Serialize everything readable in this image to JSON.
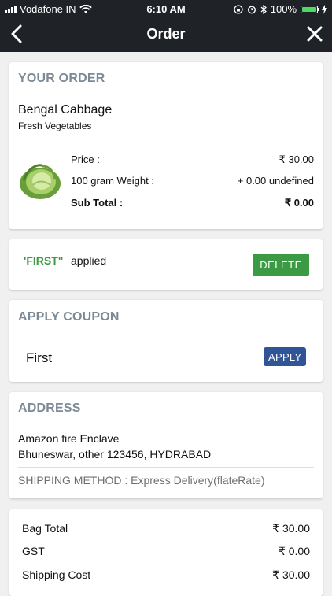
{
  "status_bar": {
    "carrier": "Vodafone IN",
    "time": "6:10 AM",
    "battery": "100%"
  },
  "header": {
    "title": "Order"
  },
  "order": {
    "section_title": "YOUR ORDER",
    "product_name": "Bengal Cabbage",
    "product_category": "Fresh Vegetables",
    "price_label": "Price :",
    "price_value": "₹ 30.00",
    "weight_label": "100 gram Weight :",
    "weight_value": "+ 0.00 undefined",
    "subtotal_label": "Sub Total :",
    "subtotal_value": "₹ 0.00"
  },
  "applied_coupon": {
    "code": "'FIRST\"",
    "text": "applied",
    "delete_label": "DELETE"
  },
  "apply_coupon": {
    "section_title": "APPLY COUPON",
    "value": "First",
    "apply_label": "APPLY"
  },
  "address": {
    "section_title": "ADDRESS",
    "line1": "Amazon fire Enclave",
    "line2": "Bhuneswar, other 123456, HYDRABAD",
    "shipping_method": "SHIPPING METHOD : Express Delivery(flateRate)"
  },
  "summary": {
    "rows": [
      {
        "label": "Bag Total",
        "value": "₹ 30.00"
      },
      {
        "label": "GST",
        "value": "₹ 0.00"
      },
      {
        "label": "Shipping Cost",
        "value": "₹ 30.00"
      }
    ]
  },
  "colors": {
    "header_bg": "#1f2327",
    "section_title": "#7c8a96",
    "applied_green": "#3c9a40",
    "delete_green": "#3d9a44",
    "apply_blue": "#2f5597",
    "battery_green": "#4cd964"
  },
  "icons": {
    "back": "chevron-left-icon",
    "close": "close-icon",
    "product": "cabbage-image"
  }
}
